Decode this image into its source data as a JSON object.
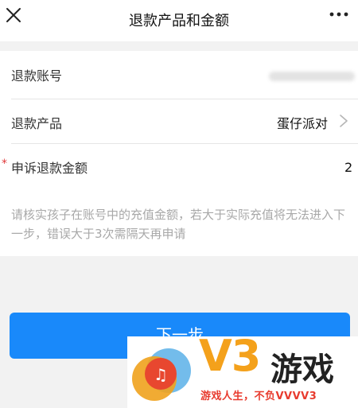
{
  "header": {
    "title": "退款产品和金额",
    "close_icon": "close-icon",
    "more_icon": "more-icon"
  },
  "form": {
    "account": {
      "label": "退款账号",
      "value": ""
    },
    "product": {
      "label": "退款产品",
      "value": "蛋仔派对"
    },
    "amount": {
      "required_mark": "*",
      "label": "申诉退款金额",
      "value": "2"
    }
  },
  "hint": "请核实孩子在账号中的充值金额，若大于实际充值将无法进入下一步，错误大于3次需隔天再申请",
  "next_button": {
    "label": "下一步"
  },
  "watermark": {
    "brand": "V3",
    "name": "游戏",
    "slogan": "游戏人生，不负VVVV3"
  },
  "colors": {
    "primary_button": "#1989fa",
    "required": "#e0383a",
    "hint_text": "#a8a8a8",
    "watermark_orange": "#f4a11b",
    "watermark_red": "#e83b2e"
  }
}
